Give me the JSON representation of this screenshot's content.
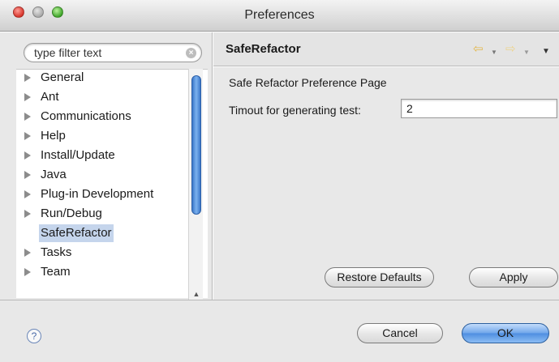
{
  "window": {
    "title": "Preferences"
  },
  "filter": {
    "placeholder": "type filter text"
  },
  "tree": {
    "items": [
      {
        "label": "General",
        "expandable": true,
        "selected": false
      },
      {
        "label": "Ant",
        "expandable": true,
        "selected": false
      },
      {
        "label": "Communications",
        "expandable": true,
        "selected": false
      },
      {
        "label": "Help",
        "expandable": true,
        "selected": false
      },
      {
        "label": "Install/Update",
        "expandable": true,
        "selected": false
      },
      {
        "label": "Java",
        "expandable": true,
        "selected": false
      },
      {
        "label": "Plug-in Development",
        "expandable": true,
        "selected": false
      },
      {
        "label": "Run/Debug",
        "expandable": true,
        "selected": false
      },
      {
        "label": "SafeRefactor",
        "expandable": false,
        "selected": true
      },
      {
        "label": "Tasks",
        "expandable": true,
        "selected": false
      },
      {
        "label": "Team",
        "expandable": true,
        "selected": false
      }
    ]
  },
  "page": {
    "title": "SafeRefactor",
    "description": "Safe Refactor Preference Page",
    "field_label": "Timout for generating test:",
    "field_value": "2",
    "restore_label": "Restore Defaults",
    "apply_label": "Apply"
  },
  "footer": {
    "help_icon": "?",
    "cancel_label": "Cancel",
    "ok_label": "OK"
  },
  "colors": {
    "selection": "#c5d5ec",
    "scroll_thumb": "#3b77c9",
    "default_button": "#6fa6ea",
    "nav_arrow": "#e3b74a"
  }
}
